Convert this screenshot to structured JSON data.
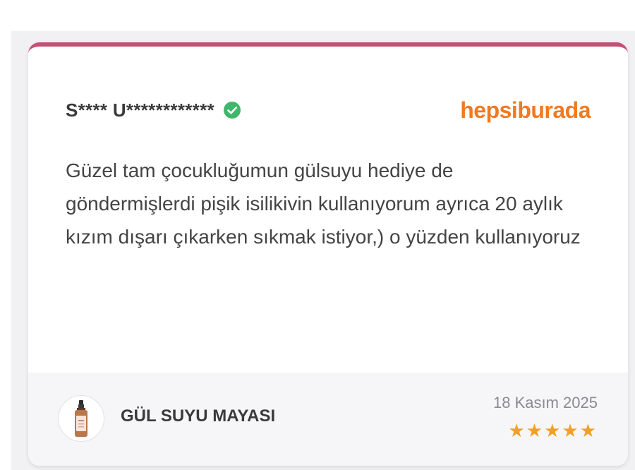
{
  "review": {
    "reviewer_name": "S**** U************",
    "verified_icon": "check-circle-icon",
    "source": "hepsiburada",
    "text": "Güzel tam çocukluğumun gülsuyu hediye de göndermişlerdi pişik isilikivin kullanıyorum ayrıca 20 aylık kızım dışarı çıkarken sıkmak istiyor,) o yüzden kullanıyoruz",
    "product_name": "GÜL SUYU MAYASI",
    "product_icon": "spray-bottle-icon",
    "date": "18 Kasım 2025",
    "rating": 5,
    "stars": [
      "★",
      "★",
      "★",
      "★",
      "★"
    ]
  },
  "colors": {
    "accent_border": "#c64f75",
    "brand": "#f07a22",
    "verified": "#3fb76b",
    "star": "#f0a02a"
  }
}
